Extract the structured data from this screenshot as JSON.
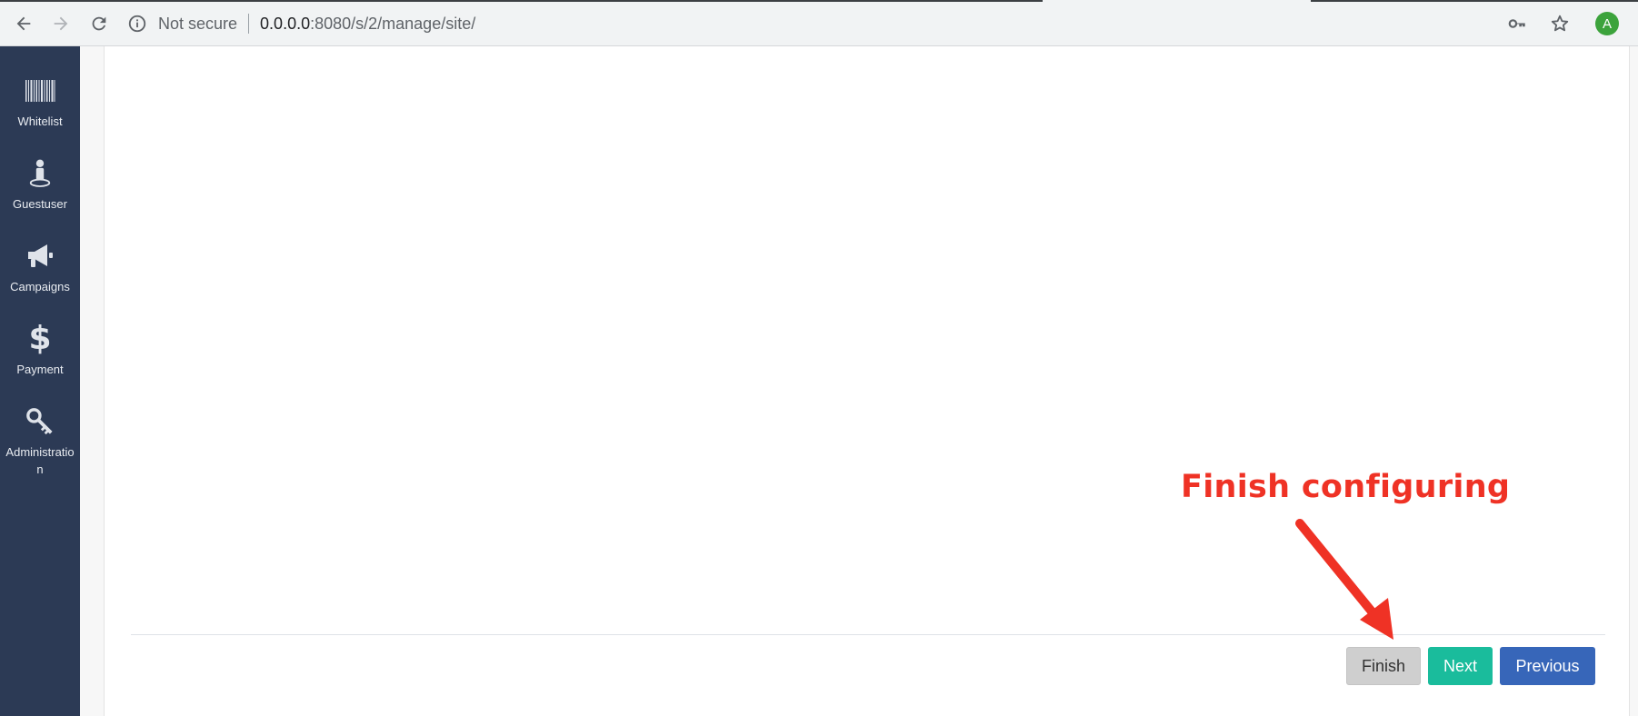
{
  "browser": {
    "security_label": "Not secure",
    "url_host": "0.0.0.0",
    "url_rest": ":8080/s/2/manage/site/",
    "avatar_letter": "A",
    "icons": [
      "back-arrow-icon",
      "forward-arrow-icon",
      "reload-icon",
      "info-icon",
      "key-icon",
      "star-icon"
    ]
  },
  "sidebar": {
    "items": [
      {
        "label": "Whitelist",
        "icon": "barcode-icon"
      },
      {
        "label": "Guestuser",
        "icon": "person-icon"
      },
      {
        "label": "Campaigns",
        "icon": "megaphone-icon"
      },
      {
        "label": "Payment",
        "icon": "dollar-icon"
      },
      {
        "label": "Administration",
        "icon": "key-icon"
      }
    ],
    "background": "#2c3a55"
  },
  "wizard": {
    "finish_label": "Finish",
    "next_label": "Next",
    "previous_label": "Previous",
    "colors": {
      "finish": "#cfcfcf",
      "next": "#1abc9c",
      "previous": "#3766b9"
    }
  },
  "annotation": {
    "text": "Finish configuring",
    "color": "#ef3225"
  }
}
